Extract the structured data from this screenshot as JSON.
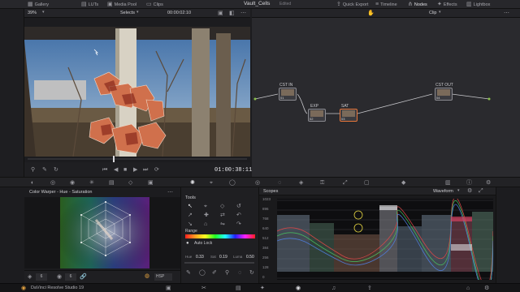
{
  "topbar": {
    "items": [
      {
        "label": "Gallery",
        "icon": "gallery-icon"
      },
      {
        "label": "LUTs",
        "icon": "luts-icon"
      },
      {
        "label": "Media Pool",
        "icon": "media-pool-icon"
      },
      {
        "label": "Clips",
        "icon": "clips-icon"
      }
    ],
    "project_title": "Vault_Cells",
    "edited_label": "Edited",
    "right_items": [
      {
        "label": "Quick Export",
        "icon": "export-icon"
      },
      {
        "label": "Timeline",
        "icon": "timeline-icon"
      },
      {
        "label": "Nodes",
        "icon": "nodes-icon"
      },
      {
        "label": "Effects",
        "icon": "effects-icon"
      },
      {
        "label": "Lightbox",
        "icon": "lightbox-icon"
      }
    ]
  },
  "viewer_bar": {
    "zoom": "39%",
    "selects": "Selects",
    "timecode": "00:00:02:10"
  },
  "node_bar": {
    "mode": "Clip"
  },
  "transport": {
    "timecode": "01:00:38:11"
  },
  "nodes": [
    {
      "label": "CST IN",
      "num": "01"
    },
    {
      "label": "EXP",
      "num": "02"
    },
    {
      "label": "SAT",
      "num": "03"
    },
    {
      "label": "CST OUT",
      "num": "04"
    }
  ],
  "warper": {
    "title": "Color Warper - Hue - Saturation",
    "field_a": "6",
    "field_b": "6",
    "space": "HSP"
  },
  "tools": {
    "title": "Tools",
    "range_label": "Range",
    "auto_lock": "Auto Lock",
    "hue_label": "Hue",
    "hue_value": "0.33",
    "sat_label": "Sat",
    "sat_value": "0.19",
    "luma_label": "Luma",
    "luma_value": "0.50"
  },
  "scopes": {
    "title": "Scopes",
    "mode": "Waveform",
    "scale": [
      "1023",
      "896",
      "768",
      "640",
      "512",
      "384",
      "256",
      "128",
      "0"
    ]
  },
  "bottombar": {
    "app_name": "DaVinci Resolve Studio 19"
  },
  "colors": {
    "accent": "#e8763a",
    "node_link": "#c8c8cc",
    "timecode": "#e6e6ea"
  }
}
